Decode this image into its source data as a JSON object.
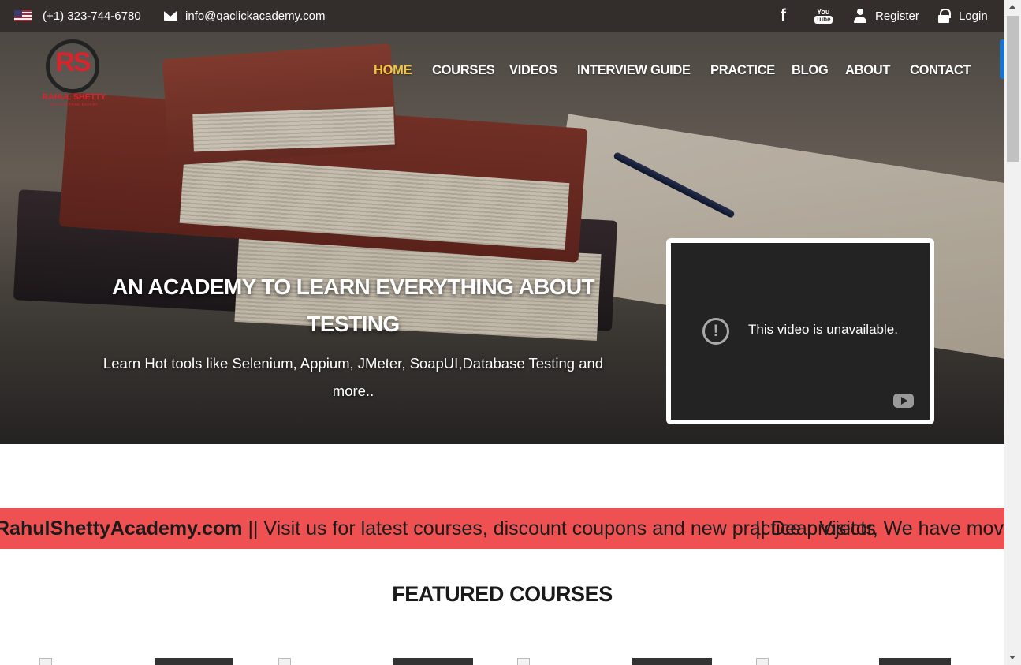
{
  "topbar": {
    "phone": "(+1) 323-744-6780",
    "email": "info@qaclickacademy.com",
    "facebook_icon": "f",
    "youtube_top": "You",
    "youtube_bottom": "Tube",
    "register": "Register",
    "login": "Login"
  },
  "logo": {
    "monogram": "RS",
    "name": "RAHUL SHETTY",
    "tagline": "BECOME TRUE EXPERT"
  },
  "nav": {
    "items": [
      "HOME",
      "COURSES",
      "VIDEOS",
      "INTERVIEW GUIDE",
      "PRACTICE",
      "BLOG",
      "ABOUT",
      "CONTACT"
    ],
    "active": "HOME",
    "active_color": "#f4c542"
  },
  "hero": {
    "title": "AN ACADEMY TO LEARN EVERYTHING ABOUT TESTING",
    "subtitle": "Learn Hot tools like Selenium, Appium, JMeter, SoapUI,Database Testing and more..",
    "video_message": "This video is unavailable.",
    "warning_glyph": "!"
  },
  "marquee": {
    "site": "RahulShettyAcademy.com",
    "text1": " || Visit us for latest courses, discount coupons and new practice projects",
    "text2": "|| Dear Visitor, We have moved"
  },
  "featured": {
    "heading": "FEATURED COURSES"
  },
  "colors": {
    "topbar": "#332e2b",
    "marquee": "#ef5051",
    "brand_red": "#d9232d"
  }
}
